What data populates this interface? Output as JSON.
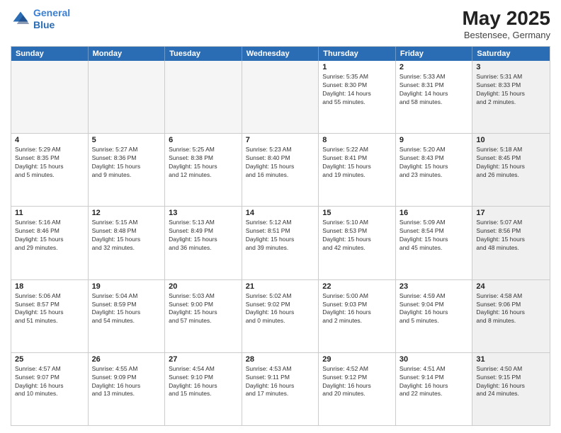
{
  "logo": {
    "line1": "General",
    "line2": "Blue"
  },
  "title": "May 2025",
  "subtitle": "Bestensee, Germany",
  "header_days": [
    "Sunday",
    "Monday",
    "Tuesday",
    "Wednesday",
    "Thursday",
    "Friday",
    "Saturday"
  ],
  "rows": [
    [
      {
        "day": "",
        "info": "",
        "empty": true
      },
      {
        "day": "",
        "info": "",
        "empty": true
      },
      {
        "day": "",
        "info": "",
        "empty": true
      },
      {
        "day": "",
        "info": "",
        "empty": true
      },
      {
        "day": "1",
        "info": "Sunrise: 5:35 AM\nSunset: 8:30 PM\nDaylight: 14 hours\nand 55 minutes."
      },
      {
        "day": "2",
        "info": "Sunrise: 5:33 AM\nSunset: 8:31 PM\nDaylight: 14 hours\nand 58 minutes."
      },
      {
        "day": "3",
        "info": "Sunrise: 5:31 AM\nSunset: 8:33 PM\nDaylight: 15 hours\nand 2 minutes.",
        "shaded": true
      }
    ],
    [
      {
        "day": "4",
        "info": "Sunrise: 5:29 AM\nSunset: 8:35 PM\nDaylight: 15 hours\nand 5 minutes."
      },
      {
        "day": "5",
        "info": "Sunrise: 5:27 AM\nSunset: 8:36 PM\nDaylight: 15 hours\nand 9 minutes."
      },
      {
        "day": "6",
        "info": "Sunrise: 5:25 AM\nSunset: 8:38 PM\nDaylight: 15 hours\nand 12 minutes."
      },
      {
        "day": "7",
        "info": "Sunrise: 5:23 AM\nSunset: 8:40 PM\nDaylight: 15 hours\nand 16 minutes."
      },
      {
        "day": "8",
        "info": "Sunrise: 5:22 AM\nSunset: 8:41 PM\nDaylight: 15 hours\nand 19 minutes."
      },
      {
        "day": "9",
        "info": "Sunrise: 5:20 AM\nSunset: 8:43 PM\nDaylight: 15 hours\nand 23 minutes."
      },
      {
        "day": "10",
        "info": "Sunrise: 5:18 AM\nSunset: 8:45 PM\nDaylight: 15 hours\nand 26 minutes.",
        "shaded": true
      }
    ],
    [
      {
        "day": "11",
        "info": "Sunrise: 5:16 AM\nSunset: 8:46 PM\nDaylight: 15 hours\nand 29 minutes."
      },
      {
        "day": "12",
        "info": "Sunrise: 5:15 AM\nSunset: 8:48 PM\nDaylight: 15 hours\nand 32 minutes."
      },
      {
        "day": "13",
        "info": "Sunrise: 5:13 AM\nSunset: 8:49 PM\nDaylight: 15 hours\nand 36 minutes."
      },
      {
        "day": "14",
        "info": "Sunrise: 5:12 AM\nSunset: 8:51 PM\nDaylight: 15 hours\nand 39 minutes."
      },
      {
        "day": "15",
        "info": "Sunrise: 5:10 AM\nSunset: 8:53 PM\nDaylight: 15 hours\nand 42 minutes."
      },
      {
        "day": "16",
        "info": "Sunrise: 5:09 AM\nSunset: 8:54 PM\nDaylight: 15 hours\nand 45 minutes."
      },
      {
        "day": "17",
        "info": "Sunrise: 5:07 AM\nSunset: 8:56 PM\nDaylight: 15 hours\nand 48 minutes.",
        "shaded": true
      }
    ],
    [
      {
        "day": "18",
        "info": "Sunrise: 5:06 AM\nSunset: 8:57 PM\nDaylight: 15 hours\nand 51 minutes."
      },
      {
        "day": "19",
        "info": "Sunrise: 5:04 AM\nSunset: 8:59 PM\nDaylight: 15 hours\nand 54 minutes."
      },
      {
        "day": "20",
        "info": "Sunrise: 5:03 AM\nSunset: 9:00 PM\nDaylight: 15 hours\nand 57 minutes."
      },
      {
        "day": "21",
        "info": "Sunrise: 5:02 AM\nSunset: 9:02 PM\nDaylight: 16 hours\nand 0 minutes."
      },
      {
        "day": "22",
        "info": "Sunrise: 5:00 AM\nSunset: 9:03 PM\nDaylight: 16 hours\nand 2 minutes."
      },
      {
        "day": "23",
        "info": "Sunrise: 4:59 AM\nSunset: 9:04 PM\nDaylight: 16 hours\nand 5 minutes."
      },
      {
        "day": "24",
        "info": "Sunrise: 4:58 AM\nSunset: 9:06 PM\nDaylight: 16 hours\nand 8 minutes.",
        "shaded": true
      }
    ],
    [
      {
        "day": "25",
        "info": "Sunrise: 4:57 AM\nSunset: 9:07 PM\nDaylight: 16 hours\nand 10 minutes."
      },
      {
        "day": "26",
        "info": "Sunrise: 4:55 AM\nSunset: 9:09 PM\nDaylight: 16 hours\nand 13 minutes."
      },
      {
        "day": "27",
        "info": "Sunrise: 4:54 AM\nSunset: 9:10 PM\nDaylight: 16 hours\nand 15 minutes."
      },
      {
        "day": "28",
        "info": "Sunrise: 4:53 AM\nSunset: 9:11 PM\nDaylight: 16 hours\nand 17 minutes."
      },
      {
        "day": "29",
        "info": "Sunrise: 4:52 AM\nSunset: 9:12 PM\nDaylight: 16 hours\nand 20 minutes."
      },
      {
        "day": "30",
        "info": "Sunrise: 4:51 AM\nSunset: 9:14 PM\nDaylight: 16 hours\nand 22 minutes."
      },
      {
        "day": "31",
        "info": "Sunrise: 4:50 AM\nSunset: 9:15 PM\nDaylight: 16 hours\nand 24 minutes.",
        "shaded": true
      }
    ]
  ]
}
